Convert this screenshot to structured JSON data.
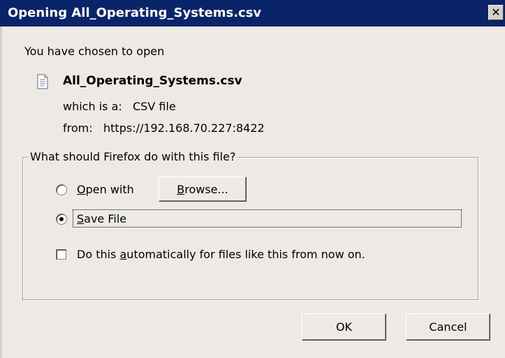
{
  "window": {
    "title": "Opening All_Operating_Systems.csv",
    "close_label": "✕"
  },
  "intro": {
    "text": "You have chosen to open"
  },
  "file": {
    "icon": "document-icon",
    "name": "All_Operating_Systems.csv",
    "which_label": "which is a:",
    "which_value": "CSV file",
    "from_label": "from:",
    "from_value": "https://192.168.70.227:8422"
  },
  "action_group": {
    "legend": "What should Firefox do with this file?",
    "options": [
      {
        "label_prefix": "",
        "label_accel": "O",
        "label_rest": "pen with",
        "selected": false
      },
      {
        "label_prefix": "",
        "label_accel": "S",
        "label_rest": "ave File",
        "selected": true
      }
    ],
    "browse": {
      "prefix": "",
      "accel": "B",
      "rest": "rowse..."
    },
    "auto_checkbox": {
      "prefix": "Do this ",
      "accel": "a",
      "rest": "utomatically for files like this from now on.",
      "checked": false
    }
  },
  "buttons": {
    "ok": "OK",
    "cancel": "Cancel"
  },
  "colors": {
    "titlebar": "#0a246a",
    "dialog_bg": "#edeae6"
  }
}
